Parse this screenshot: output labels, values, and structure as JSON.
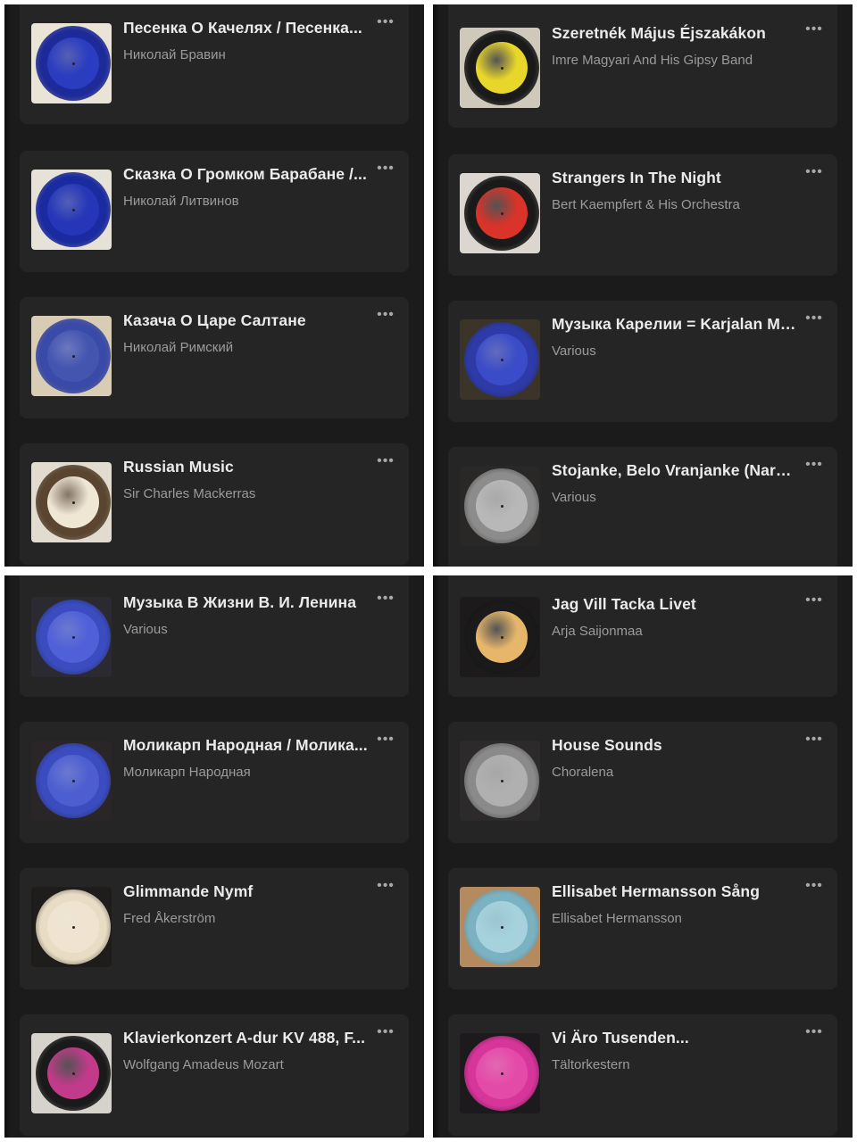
{
  "panels": [
    {
      "id": "top-left",
      "items": [
        {
          "title": "Песенка О Качелях / Песенка...",
          "artist": "Николай Бравин",
          "cover": {
            "bg": "#e9e4d6",
            "disc": "#1d2a9a",
            "label": "#2a3cc0"
          }
        },
        {
          "title": "Сказка О Громком Барабане /...",
          "artist": "Николай Литвинов",
          "cover": {
            "bg": "#e6e2d8",
            "disc": "#1a2aa0",
            "label": "#2536b8"
          }
        },
        {
          "title": "Казача О Царе Салтане",
          "artist": "Николай Римский",
          "cover": {
            "bg": "#d8ccb4",
            "disc": "#3a4aa8",
            "label": "#4455b0"
          }
        },
        {
          "title": "Russian Music",
          "artist": "Sir Charles Mackerras",
          "cover": {
            "bg": "#e2dcd0",
            "disc": "#5a4630",
            "label": "#efe6d4"
          }
        }
      ]
    },
    {
      "id": "top-right",
      "items": [
        {
          "title": "Szeretnék Május Éjszakákon",
          "artist": "Imre Magyari And His Gipsy Band",
          "cover": {
            "bg": "#cfc9bb",
            "disc": "#1a1a1a",
            "label": "#e8d62a"
          }
        },
        {
          "title": "Strangers In The Night",
          "artist": "Bert Kaempfert & His Orchestra",
          "cover": {
            "bg": "#dbd7d0",
            "disc": "#1a1a1a",
            "label": "#d9332a"
          }
        },
        {
          "title": "Музыка Карелии = Karjalan Mu...",
          "artist": "Various",
          "cover": {
            "bg": "#3b3429",
            "disc": "#2d3aa8",
            "label": "#3a4cc8"
          }
        },
        {
          "title": "Stojanke, Belo Vranjanke (Naro...",
          "artist": "Various",
          "cover": {
            "bg": "#2a2826",
            "disc": "#8c8c8c",
            "label": "#b8b8b8"
          }
        }
      ]
    },
    {
      "id": "bottom-left",
      "items": [
        {
          "title": "Музыка В Жизни В. И. Ленина",
          "artist": "Various",
          "cover": {
            "bg": "#2b2a30",
            "disc": "#3a4cc0",
            "label": "#5060d8"
          }
        },
        {
          "title": "Моликарп Народная / Молика...",
          "artist": "Моликарп Народная",
          "cover": {
            "bg": "#2a2628",
            "disc": "#3a4cc0",
            "label": "#4d5ed0"
          }
        },
        {
          "title": "Glimmande Nymf",
          "artist": "Fred Åkerström",
          "cover": {
            "bg": "#1f1d1c",
            "disc": "#e8dcc4",
            "label": "#f0e4d0"
          }
        },
        {
          "title": "Klavierkonzert A-dur KV 488, F...",
          "artist": "Wolfgang Amadeus Mozart",
          "cover": {
            "bg": "#d6d2cc",
            "disc": "#1a1a1a",
            "label": "#c23a8a"
          }
        }
      ]
    },
    {
      "id": "bottom-right",
      "items": [
        {
          "title": "Jag Vill Tacka Livet",
          "artist": "Arja Saijonmaa",
          "cover": {
            "bg": "#1c1a1b",
            "disc": "#1a1a1a",
            "label": "#e6b66a"
          }
        },
        {
          "title": "House Sounds",
          "artist": "Choralena",
          "cover": {
            "bg": "#2c2a2a",
            "disc": "#8a8a8a",
            "label": "#b0b0b0"
          }
        },
        {
          "title": "Ellisabet Hermansson Sång",
          "artist": "Ellisabet Hermansson",
          "cover": {
            "bg": "#b58a5e",
            "disc": "#7ab2c2",
            "label": "#a6d2de"
          }
        },
        {
          "title": "Vi Äro Tusenden...",
          "artist": "Tältorkestern",
          "cover": {
            "bg": "#1c1a1c",
            "disc": "#d8359a",
            "label": "#e44aa8"
          }
        }
      ]
    }
  ],
  "more_glyph": "•••"
}
